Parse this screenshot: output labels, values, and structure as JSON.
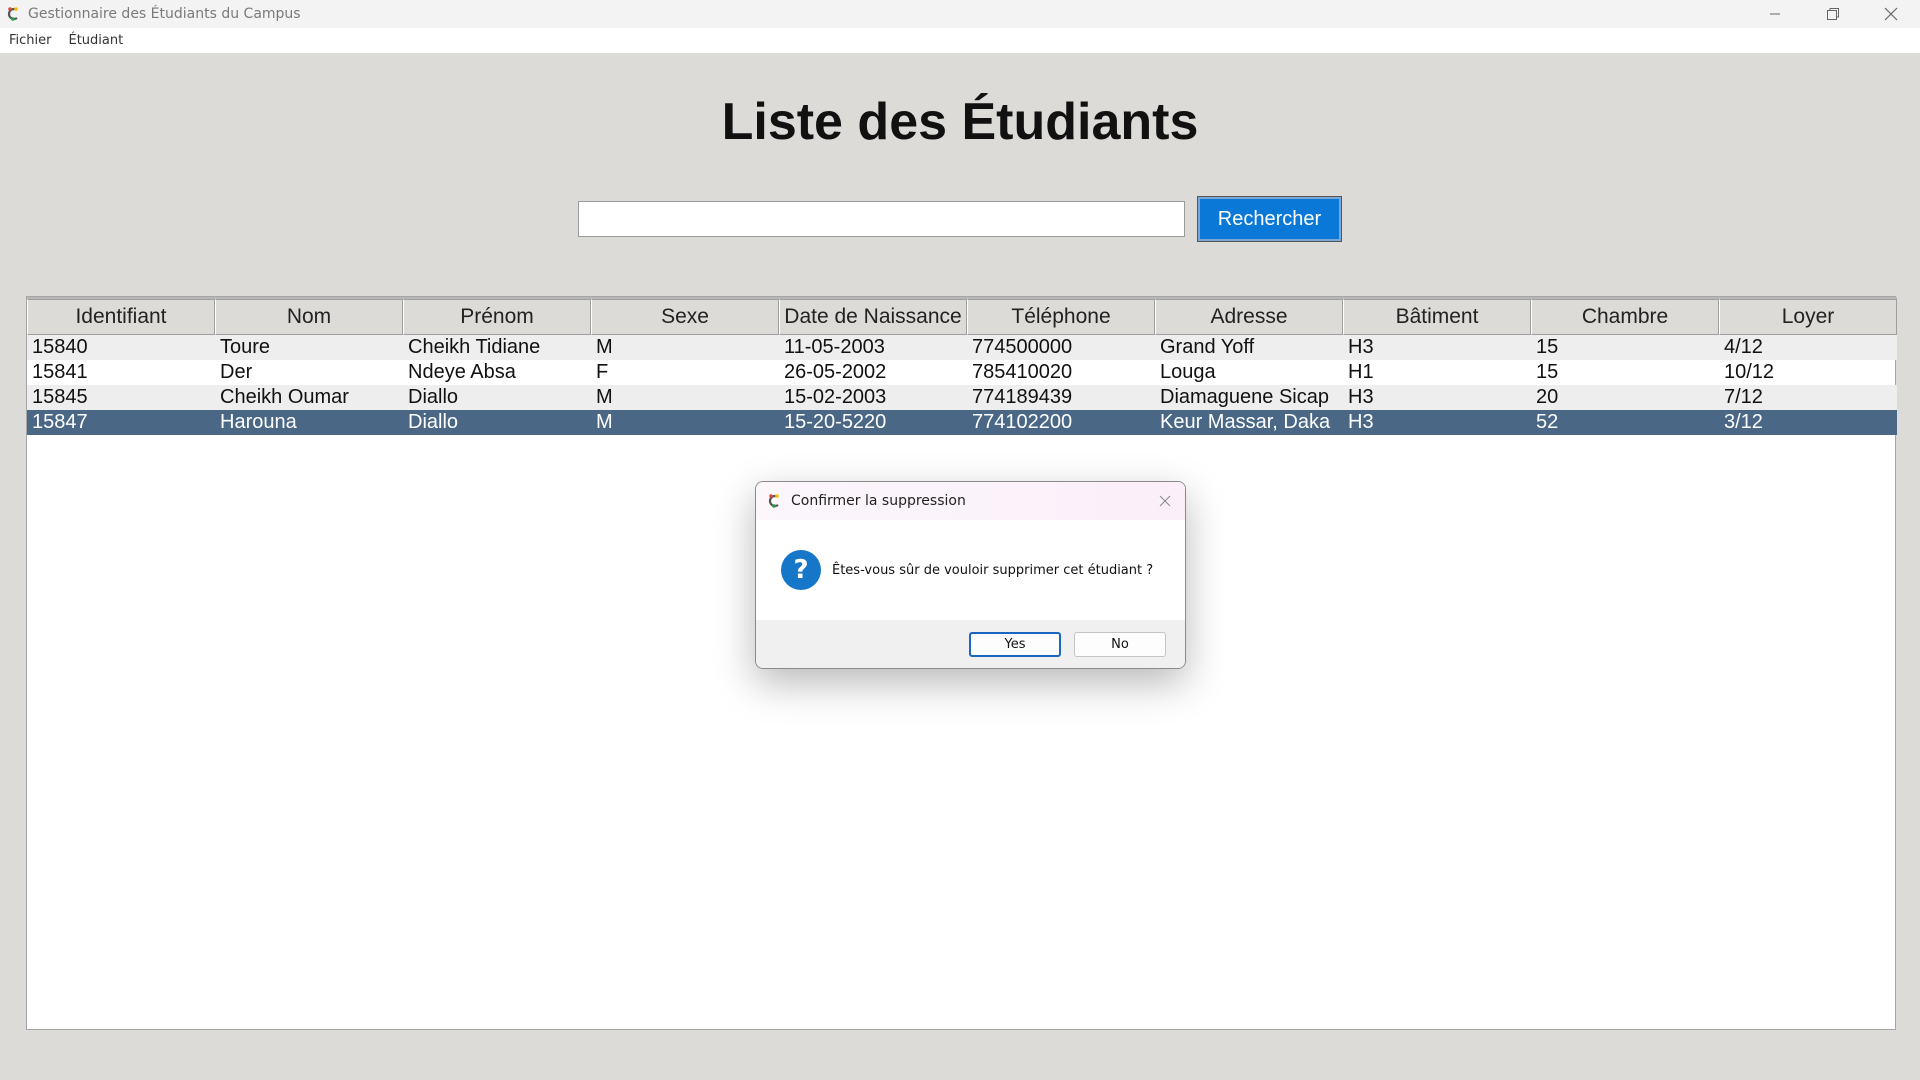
{
  "window": {
    "title": "Gestionnaire des Étudiants du Campus",
    "controls": [
      "minimize-icon",
      "restore-icon",
      "close-icon"
    ]
  },
  "menu": {
    "items": [
      {
        "label": "Fichier"
      },
      {
        "label": "Étudiant"
      }
    ]
  },
  "main": {
    "title": "Liste des Étudiants",
    "search": {
      "value": "",
      "placeholder": "",
      "button_label": "Rechercher"
    }
  },
  "table": {
    "columns": [
      "Identifiant",
      "Nom",
      "Prénom",
      "Sexe",
      "Date de Naissance",
      "Téléphone",
      "Adresse",
      "Bâtiment",
      "Chambre",
      "Loyer"
    ],
    "rows": [
      [
        "15840",
        "Toure",
        "Cheikh Tidiane",
        "M",
        "11-05-2003",
        "774500000",
        "Grand Yoff",
        "H3",
        "15",
        "4/12"
      ],
      [
        "15841",
        "Der",
        "Ndeye Absa",
        "F",
        "26-05-2002",
        "785410020",
        "Louga",
        "H1",
        "15",
        "10/12"
      ],
      [
        "15845",
        "Cheikh Oumar",
        "Diallo",
        "M",
        "15-02-2003",
        "774189439",
        "Diamaguene Sicap",
        "H3",
        "20",
        "7/12"
      ],
      [
        "15847",
        "Harouna",
        "Diallo",
        "M",
        "15-20-5220",
        "774102200",
        "Keur Massar, Daka",
        "H3",
        "52",
        "3/12"
      ]
    ],
    "selected_row": 3
  },
  "dialog": {
    "title": "Confirmer la suppression",
    "message": "Êtes-vous sûr de vouloir supprimer cet étudiant ?",
    "yes_label": "Yes",
    "no_label": "No",
    "icon": "question-icon"
  },
  "colors": {
    "accent": "#0a78d7",
    "selected_row": "#4a6885",
    "background": "#dcdbd8"
  }
}
